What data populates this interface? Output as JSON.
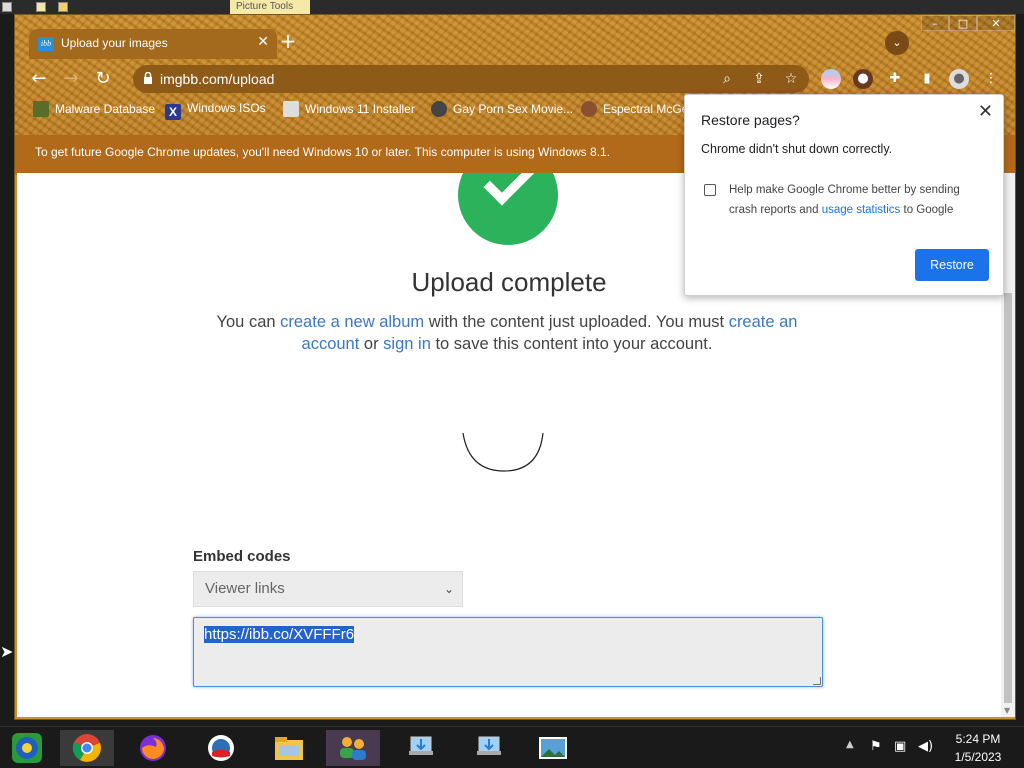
{
  "desktop": {
    "picture_tools_label": "Picture Tools"
  },
  "window_controls": {
    "minimize": "–",
    "maximize": "□",
    "close": "✕"
  },
  "tab": {
    "favicon_text": "ibb",
    "title": "Upload your images",
    "close": "✕",
    "new_tab": "+"
  },
  "toolbar": {
    "back": "←",
    "forward": "→",
    "reload": "↻",
    "url": "imgbb.com/upload"
  },
  "bookmarks": [
    {
      "label": "Malware Database",
      "icon": "bug-icon"
    },
    {
      "label": "Windows ISOs",
      "icon": "x-icon"
    },
    {
      "label": "Windows 11 Installer",
      "icon": "installer-icon"
    },
    {
      "label": "Gay Porn Sex Movie...",
      "icon": "site-icon"
    },
    {
      "label": "Espectral McGe...",
      "icon": "avatar-icon"
    }
  ],
  "infobar": {
    "text": "To get future Google Chrome updates, you'll need Windows 10 or later. This computer is using Windows 8.1."
  },
  "page": {
    "title": "Upload complete",
    "desc_1": "You can ",
    "link_album": "create a new album",
    "desc_2": " with the content just uploaded. You must ",
    "link_account": "create an account",
    "desc_3": " or ",
    "link_signin": "sign in",
    "desc_4": " to save this content into your account.",
    "embed_label": "Embed codes",
    "embed_select": "Viewer links",
    "embed_value": "https://ibb.co/XVFFFr6"
  },
  "restore": {
    "title": "Restore pages?",
    "message": "Chrome didn't shut down correctly.",
    "help_1": "Help make Google Chrome better by sending crash reports and ",
    "help_link": "usage statistics",
    "help_2": " to Google",
    "button": "Restore"
  },
  "clock": {
    "time": "5:24 PM",
    "date": "1/5/2023"
  },
  "colors": {
    "brand_blue": "#1a73e8",
    "link_blue": "#3b78c2",
    "success_green": "#2bb25a",
    "theme_amber": "#c8922e"
  }
}
